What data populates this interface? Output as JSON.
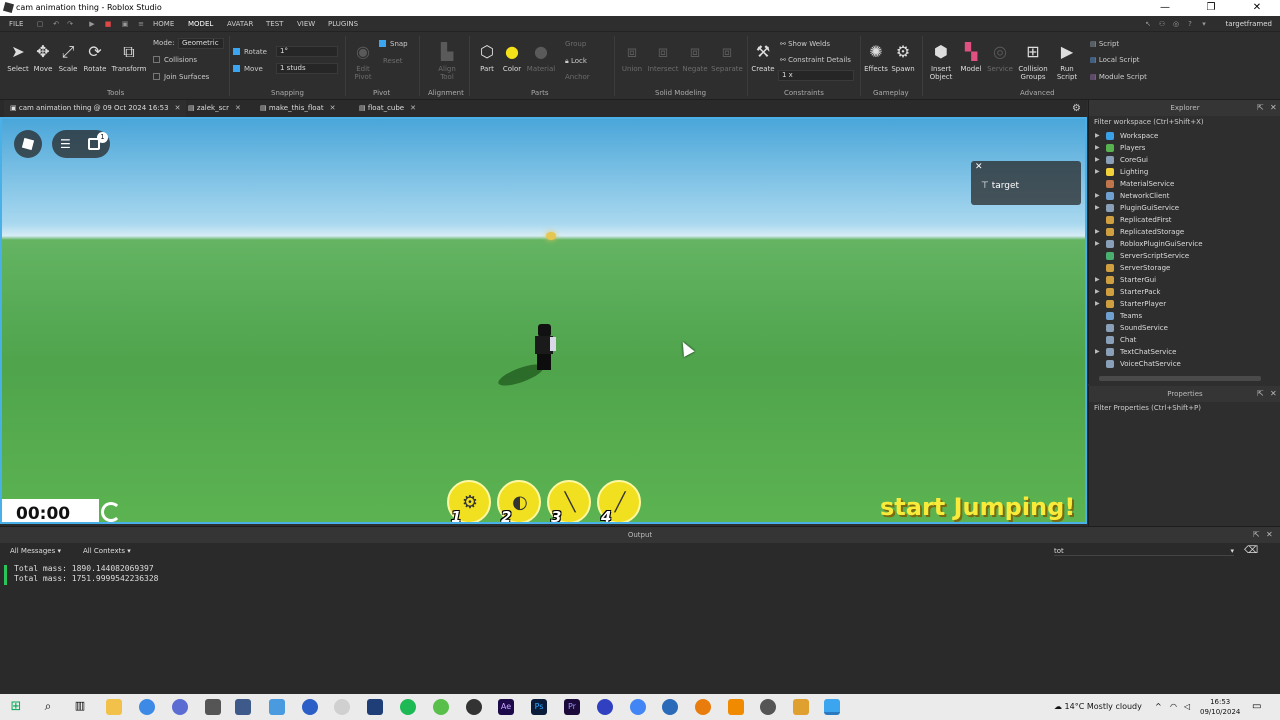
{
  "window": {
    "title": "cam animation thing - Roblox Studio",
    "min": "—",
    "max": "❐",
    "close": "✕"
  },
  "menubar": {
    "file": "FILE",
    "tabs": [
      "HOME",
      "MODEL",
      "AVATAR",
      "TEST",
      "VIEW",
      "PLUGINS"
    ],
    "active_tab": "MODEL",
    "user": "targetframed"
  },
  "ribbon": {
    "tools": {
      "select": "Select",
      "move": "Move",
      "scale": "Scale",
      "rotate": "Rotate",
      "transform": "Transform",
      "group": "Tools"
    },
    "mode": {
      "label": "Mode:",
      "value": "Geometric"
    },
    "collisions": "Collisions",
    "join_surfaces": "Join Surfaces",
    "snapping": {
      "rotate_label": "Rotate",
      "rotate_value": "1°",
      "move_label": "Move",
      "move_value": "1 studs",
      "group": "Snapping"
    },
    "pivot": {
      "edit": "Edit Pivot",
      "snap": "Snap",
      "reset": "Reset",
      "group": "Pivot"
    },
    "alignment": {
      "align": "Align Tool",
      "group": "Alignment"
    },
    "parts": {
      "part": "Part",
      "color": "Color",
      "material": "Material",
      "group_btn": "Group",
      "lock": "Lock",
      "anchor": "Anchor",
      "group": "Parts"
    },
    "solid": {
      "union": "Union",
      "intersect": "Intersect",
      "negate": "Negate",
      "separate": "Separate",
      "group": "Solid Modeling"
    },
    "constraints": {
      "create": "Create",
      "show_welds": "Show Welds",
      "details": "Constraint Details",
      "scale": "1 x",
      "group": "Constraints"
    },
    "gameplay": {
      "effects": "Effects",
      "spawn": "Spawn",
      "group": "Gameplay"
    },
    "advanced": {
      "insert": "Insert Object",
      "model": "Model",
      "service": "Service",
      "collision": "Collision Groups",
      "run": "Run Script",
      "script": "Script",
      "local_script": "Local Script",
      "module_script": "Module Script",
      "group": "Advanced"
    }
  },
  "doc_tabs": [
    {
      "label": "cam animation thing @ 09 Oct 2024 16:53"
    },
    {
      "label": "zalek_scr"
    },
    {
      "label": "make_this_float"
    },
    {
      "label": "float_cube"
    }
  ],
  "game": {
    "badge_count": "1",
    "target_label": "target",
    "timer": "00:00",
    "hotbar": [
      "1",
      "2",
      "3",
      "4"
    ],
    "banner": "start Jumping!"
  },
  "explorer": {
    "title": "Explorer",
    "filter": "Filter workspace (Ctrl+Shift+X)",
    "items": [
      {
        "label": "Workspace",
        "color": "#3aa0e8",
        "expand": true
      },
      {
        "label": "Players",
        "color": "#57b24f",
        "expand": true
      },
      {
        "label": "CoreGui",
        "color": "#8aa0b8",
        "expand": true
      },
      {
        "label": "Lighting",
        "color": "#f2d13a",
        "expand": true
      },
      {
        "label": "MaterialService",
        "color": "#c0764a",
        "expand": false
      },
      {
        "label": "NetworkClient",
        "color": "#6fa0d0",
        "expand": true
      },
      {
        "label": "PluginGuiService",
        "color": "#8aa0b8",
        "expand": true
      },
      {
        "label": "ReplicatedFirst",
        "color": "#d0a040",
        "expand": false
      },
      {
        "label": "ReplicatedStorage",
        "color": "#d0a040",
        "expand": true
      },
      {
        "label": "RobloxPluginGuiService",
        "color": "#8aa0b8",
        "expand": true
      },
      {
        "label": "ServerScriptService",
        "color": "#4ab070",
        "expand": false
      },
      {
        "label": "ServerStorage",
        "color": "#d0a040",
        "expand": false
      },
      {
        "label": "StarterGui",
        "color": "#d0a040",
        "expand": true
      },
      {
        "label": "StarterPack",
        "color": "#d0a040",
        "expand": true
      },
      {
        "label": "StarterPlayer",
        "color": "#d0a040",
        "expand": true
      },
      {
        "label": "Teams",
        "color": "#6fa0d0",
        "expand": false
      },
      {
        "label": "SoundService",
        "color": "#8aa0b8",
        "expand": false
      },
      {
        "label": "Chat",
        "color": "#8aa0b8",
        "expand": false
      },
      {
        "label": "TextChatService",
        "color": "#8aa0b8",
        "expand": true
      },
      {
        "label": "VoiceChatService",
        "color": "#8aa0b8",
        "expand": false
      }
    ]
  },
  "properties": {
    "title": "Properties",
    "filter": "Filter Properties (Ctrl+Shift+P)"
  },
  "output": {
    "title": "Output",
    "messages_filter": "All Messages",
    "contexts_filter": "All Contexts",
    "search": "tot",
    "lines": [
      "Total mass: 1890.144082069397",
      "Total mass: 1751.9999542236328"
    ]
  },
  "taskbar": {
    "weather": "14°C  Mostly cloudy",
    "time": "16:53",
    "date": "09/10/2024"
  }
}
